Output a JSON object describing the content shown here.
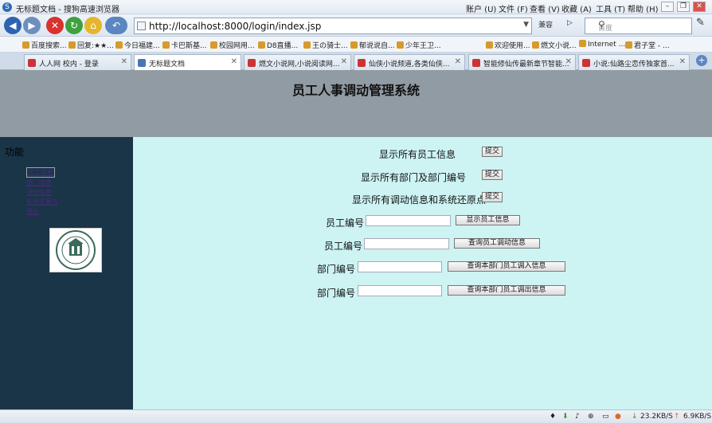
{
  "window": {
    "title": "无标题文档 - 搜狗高速浏览器",
    "menus": [
      "帮助 (H)",
      "工具 (T)",
      "收藏 (A)",
      "查看 (V)",
      "文件 (F)",
      "账户 (U)"
    ]
  },
  "toolbar": {
    "url": "http://localhost:8000/login/index.jsp",
    "compat": "兼容",
    "search_placeholder": "百度"
  },
  "favorites": [
    "百度搜索...",
    "回复:★★...",
    "今日福建...",
    "卡巴斯基...",
    "校园网用...",
    "D8直播...",
    "王の骑士...",
    "郁说说自...",
    "少年王卫...",
    "欢迎使用...",
    "燃文小说...",
    "Internet ...",
    "君子堂 - ..."
  ],
  "tabs": [
    {
      "label": "人人网 校内 - 登录"
    },
    {
      "label": "无标题文档"
    },
    {
      "label": "燃文小说网,小说阅读网..."
    },
    {
      "label": "仙侠小说频道,各类仙侠..."
    },
    {
      "label": "智能修仙传最新章节智能..."
    },
    {
      "label": "小说:仙路尘恋传独家首..."
    }
  ],
  "page": {
    "title": "员工人事调动管理系统"
  },
  "sidebar": {
    "title": "功能",
    "links": [
      "员工信息",
      "部门信息",
      "调动信息",
      "系统还原点",
      "退出"
    ]
  },
  "form": {
    "rows": [
      {
        "label": "显示所有员工信息",
        "button": "提交"
      },
      {
        "label": "显示所有部门及部门编号",
        "button": "提交"
      },
      {
        "label": "显示所有调动信息和系统还原点",
        "button": "提交"
      },
      {
        "label": "员工编号",
        "button": "显示员工信息",
        "value": ""
      },
      {
        "label": "员工编号",
        "button": "查询员工调动信息",
        "value": ""
      },
      {
        "label": "部门编号",
        "button": "查询本部门员工调入信息",
        "value": ""
      },
      {
        "label": "部门编号",
        "button": "查询本部门员工调出信息",
        "value": ""
      }
    ]
  },
  "status": {
    "down": "23.2KB/S",
    "up": "6.9KB/S"
  },
  "colors": {
    "header": "#919ba3",
    "sidebar": "#1a3448",
    "main": "#cdf3f3"
  }
}
